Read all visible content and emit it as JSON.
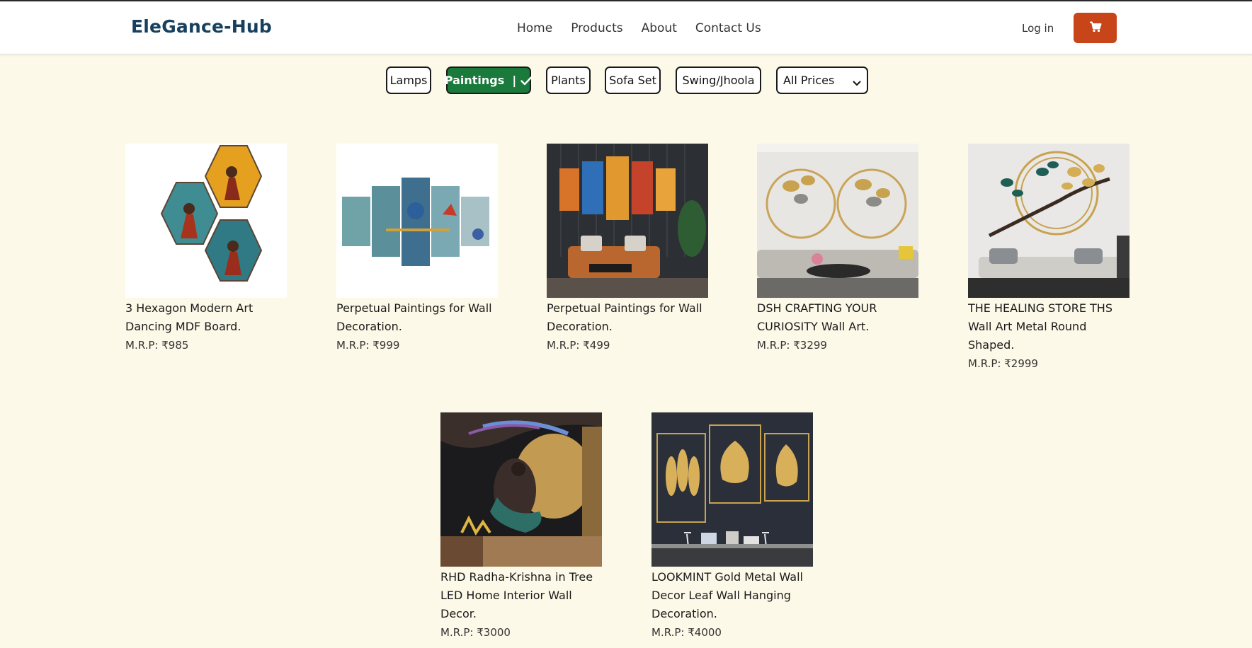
{
  "header": {
    "brand": "EleGance-Hub",
    "nav": [
      "Home",
      "Products",
      "About",
      "Contact Us"
    ],
    "login_label": "Log in",
    "cart_icon": "cart-icon",
    "cart_color": "#c8451a"
  },
  "filters": {
    "categories": [
      {
        "label": "Lamps",
        "active": false
      },
      {
        "label": "Paintings  |",
        "active": true
      },
      {
        "label": "Plants",
        "active": false
      },
      {
        "label": "Sofa Set",
        "active": false
      },
      {
        "label": "Swing/Jhoola",
        "active": false
      }
    ],
    "price_select": "All Prices",
    "active_color": "#1a7a3c"
  },
  "products": [
    {
      "title": "3 Hexagon Modern Art Dancing MDF Board.",
      "price": "M.R.P: ₹985"
    },
    {
      "title": "Perpetual Paintings for Wall Decoration.",
      "price": "M.R.P: ₹999"
    },
    {
      "title": "Perpetual Paintings for Wall Decoration.",
      "price": "M.R.P: ₹499"
    },
    {
      "title": "DSH CRAFTING YOUR CURIOSITY Wall Art.",
      "price": "M.R.P: ₹3299"
    },
    {
      "title": "THE HEALING STORE THS Wall Art Metal Round Shaped.",
      "price": "M.R.P: ₹2999"
    },
    {
      "title": "RHD Radha-Krishna in Tree LED Home Interior Wall Decor.",
      "price": "M.R.P: ₹3000"
    },
    {
      "title": "LOOKMINT Gold Metal Wall Decor Leaf Wall Hanging Decoration.",
      "price": "M.R.P: ₹4000"
    }
  ]
}
